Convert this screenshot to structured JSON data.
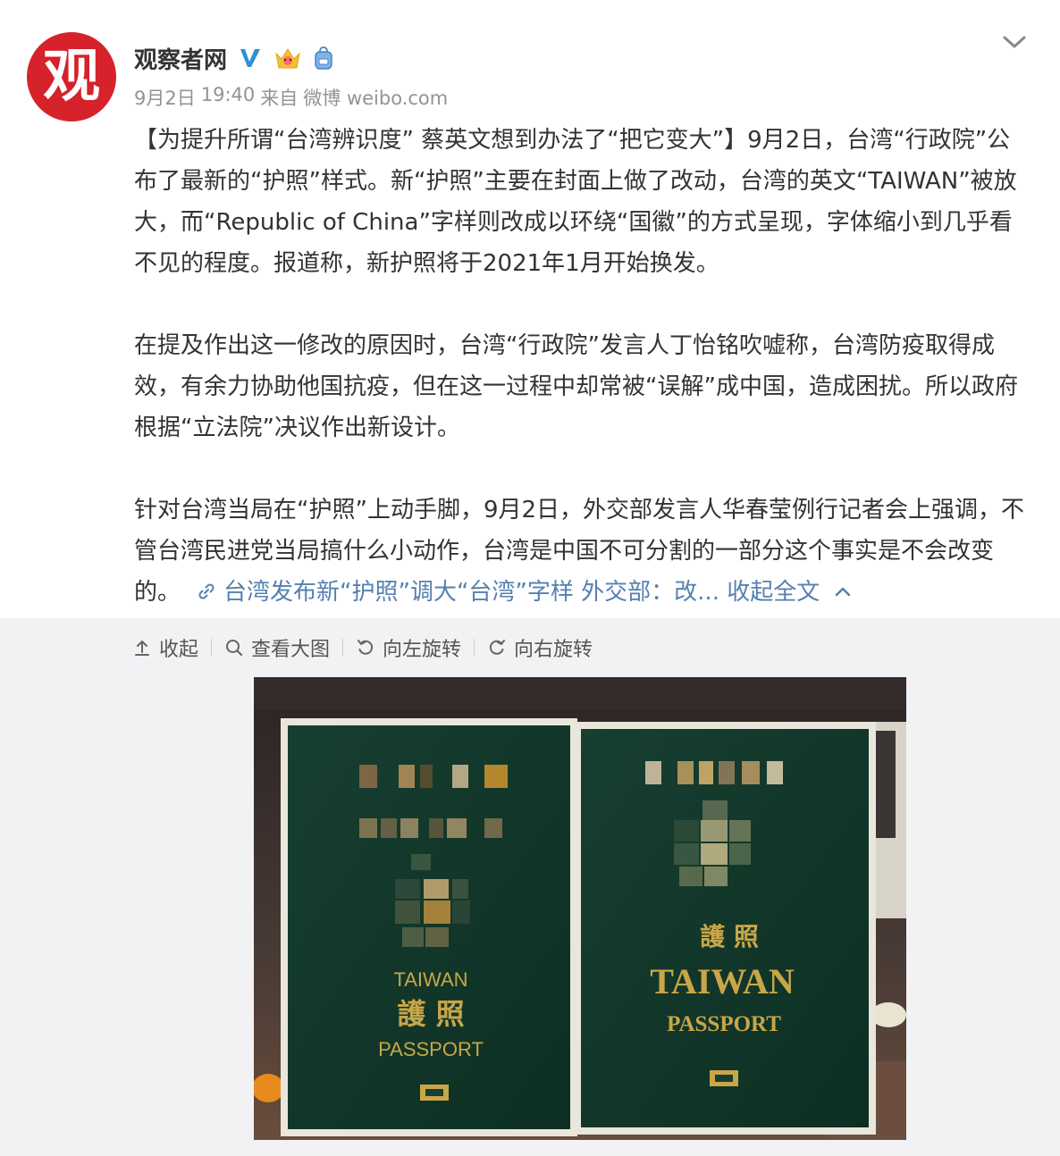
{
  "user": {
    "name": "观察者网",
    "avatar_char": "观",
    "verified_icon": "verified-v-icon",
    "badge_icons": [
      "crown-icon",
      "backpack-icon"
    ]
  },
  "meta": {
    "date": "9月2日",
    "time": "19:40",
    "source_prefix": "来自",
    "source": "微博 weibo.com"
  },
  "post": {
    "paragraph1": "【为提升所谓“台湾辨识度” 蔡英文想到办法了“把它变大”】9月2日，台湾“行政院”公布了最新的“护照”样式。新“护照”主要在封面上做了改动，台湾的英文“TAIWAN”被放大，而“Republic of China”字样则改成以环绕“国徽”的方式呈现，字体缩小到几乎看不见的程度。报道称，新护照将于2021年1月开始换发。",
    "paragraph2": "在提及作出这一修改的原因时，台湾“行政院”发言人丁怡铭吹嘘称，台湾防疫取得成效，有余力协助他国抗疫，但在这一过程中却常被“误解”成中国，造成困扰。所以政府根据“立法院”决议作出新设计。",
    "paragraph3": "针对台湾当局在“护照”上动手脚，9月2日，外交部发言人华春莹例行记者会上强调，不管台湾民进党当局搞什么小动作，台湾是中国不可分割的一部分这个事实是不会改变的。",
    "link_text": "台湾发布新“护照”调大“台湾”字样 外交部：改...",
    "collapse_text": "收起全文"
  },
  "toolbar": {
    "collapse": "收起",
    "view_large": "查看大图",
    "rotate_left": "向左旋转",
    "rotate_right": "向右旋转"
  },
  "image": {
    "left_passport": {
      "line1": "TAIWAN",
      "line2": "護 照",
      "line3": "PASSPORT"
    },
    "right_passport": {
      "line1": "護 照",
      "line2": "TAIWAN",
      "line3": "PASSPORT"
    }
  },
  "colors": {
    "brand_red": "#d6222a",
    "link_blue": "#5580b0",
    "verified_blue": "#2f8fd8",
    "passport_green": "#113a2c",
    "gold": "#c9a647"
  }
}
